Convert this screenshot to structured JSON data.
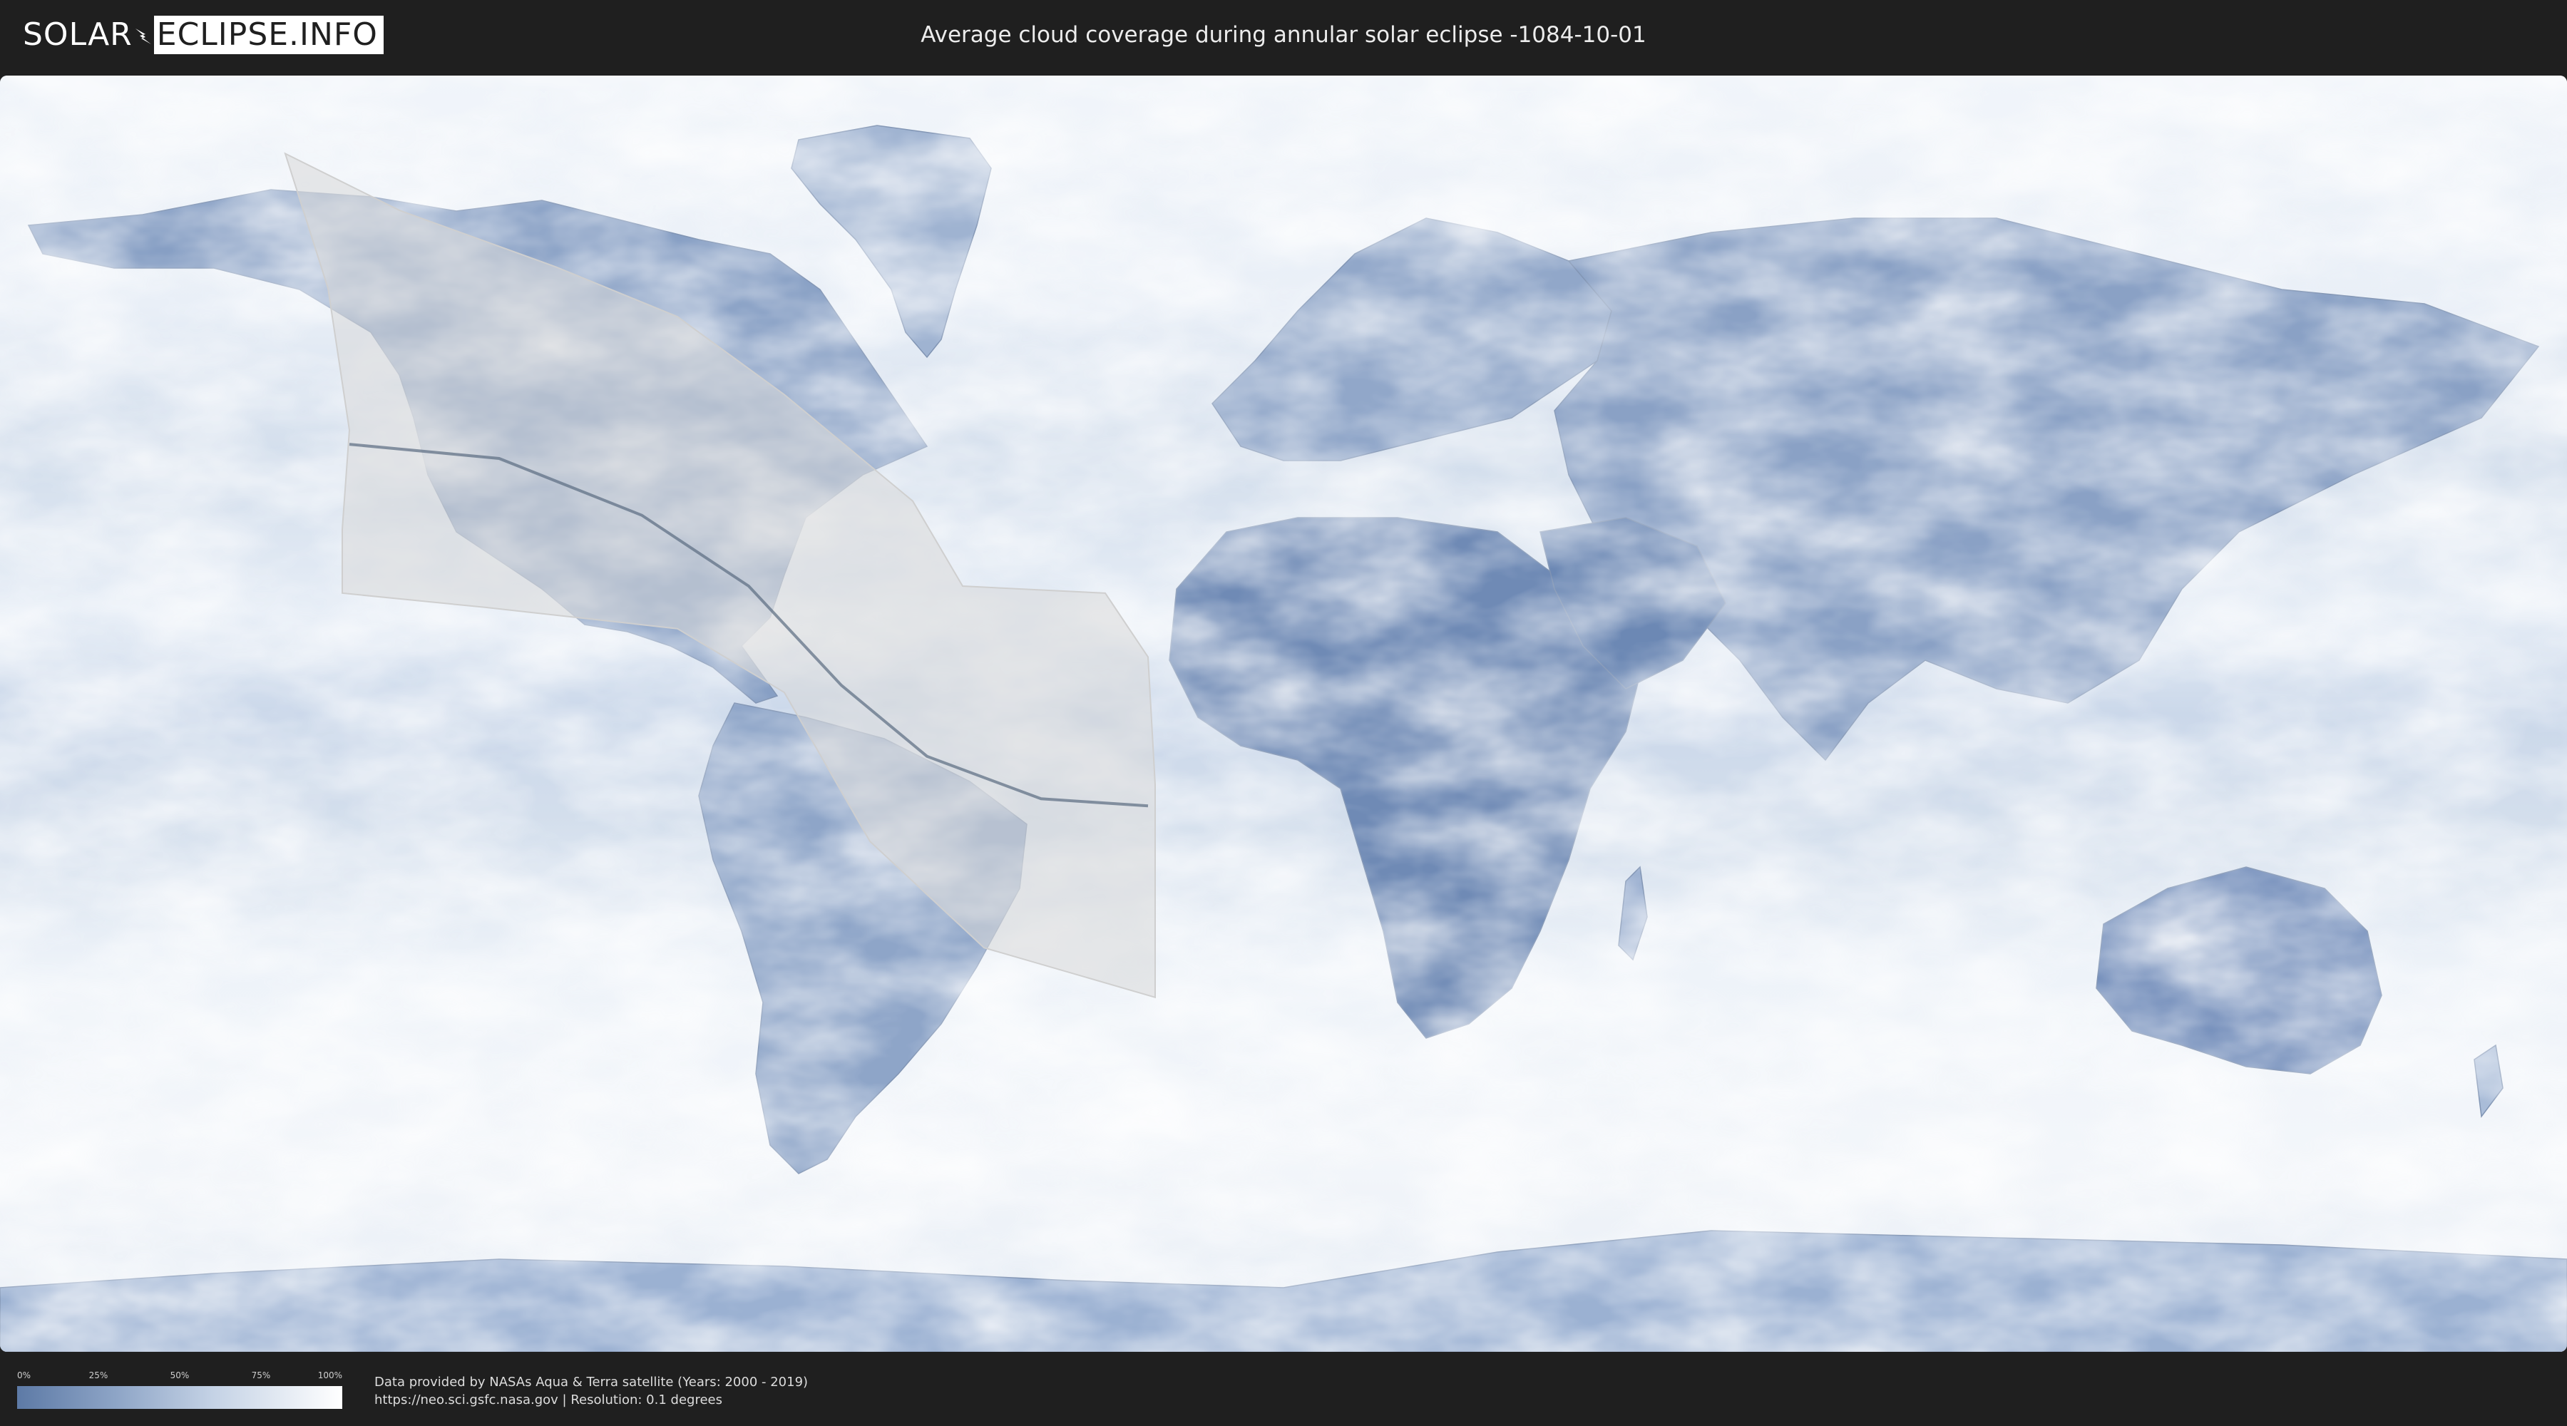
{
  "header": {
    "logo_part1": "SOLAR",
    "logo_part2": "ECLIPSE.INFO",
    "title": "Average cloud coverage during annular solar eclipse -1084-10-01"
  },
  "legend": {
    "ticks": [
      "0%",
      "25%",
      "50%",
      "75%",
      "100%"
    ],
    "gradient_from": "#5d7aa6",
    "gradient_to": "#ffffff"
  },
  "footer": {
    "credit_line1": "Data provided by NASAs Aqua & Terra satellite (Years: 2000 - 2019)",
    "credit_line2": "https://neo.sci.gsfc.nasa.gov | Resolution: 0.1 degrees"
  },
  "map": {
    "projection": "equirectangular",
    "ocean_color": "#dde6f1",
    "land_clear_sky_color": "#6e88b3",
    "eclipse_shadow_color": "#d9d9d9",
    "central_line_color": "#5a6b80",
    "eclipse_zone": {
      "north_edge": [
        [
          -140,
          79
        ],
        [
          -124,
          71
        ],
        [
          -102,
          63
        ],
        [
          -85,
          56
        ],
        [
          -70,
          45
        ],
        [
          -52,
          30
        ],
        [
          -45,
          18
        ]
      ],
      "west_edge": [
        [
          -140,
          79
        ],
        [
          -134,
          60
        ],
        [
          -131,
          40
        ],
        [
          -132,
          26
        ],
        [
          -132,
          17
        ]
      ],
      "south_edge": [
        [
          -132,
          17
        ],
        [
          -112,
          15
        ],
        [
          -85,
          12
        ],
        [
          -70,
          3
        ],
        [
          -58,
          -18
        ],
        [
          -42,
          -33
        ],
        [
          -18,
          -40
        ]
      ],
      "east_edge": [
        [
          -45,
          18
        ],
        [
          -25,
          17
        ],
        [
          -19,
          8
        ],
        [
          -18,
          -10
        ],
        [
          -18,
          -40
        ]
      ]
    },
    "central_line": [
      [
        -131,
        38
      ],
      [
        -110,
        36
      ],
      [
        -90,
        28
      ],
      [
        -75,
        18
      ],
      [
        -62,
        4
      ],
      [
        -50,
        -6
      ],
      [
        -34,
        -12
      ],
      [
        -19,
        -13
      ]
    ]
  }
}
